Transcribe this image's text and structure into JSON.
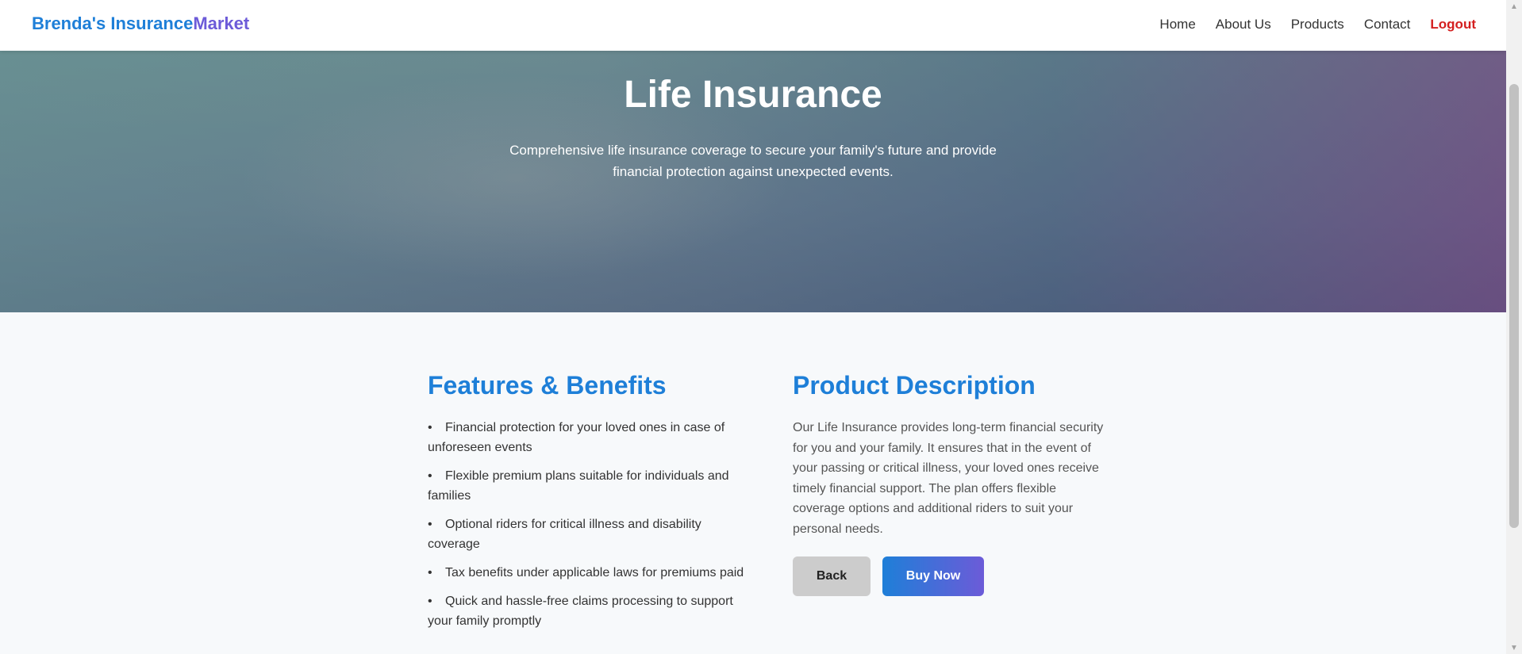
{
  "header": {
    "brand_part1": "Brenda's Insurance",
    "brand_part2": "Market",
    "nav": {
      "home": "Home",
      "about": "About Us",
      "products": "Products",
      "contact": "Contact",
      "logout": "Logout"
    }
  },
  "hero": {
    "title": "Life Insurance",
    "subtitle": "Comprehensive life insurance coverage to secure your family's future and provide financial protection against unexpected events."
  },
  "features": {
    "heading": "Features & Benefits",
    "items": [
      "Financial protection for your loved ones in case of unforeseen events",
      "Flexible premium plans suitable for individuals and families",
      "Optional riders for critical illness and disability coverage",
      "Tax benefits under applicable laws for premiums paid",
      "Quick and hassle-free claims processing to support your family promptly"
    ]
  },
  "description": {
    "heading": "Product Description",
    "body": "Our Life Insurance provides long-term financial security for you and your family. It ensures that in the event of your passing or critical illness, your loved ones receive timely financial support. The plan offers flexible coverage options and additional riders to suit your personal needs.",
    "back_label": "Back",
    "buy_label": "Buy Now"
  },
  "scrollbar": {
    "up_icon": "▲",
    "down_icon": "▼"
  },
  "colors": {
    "brand_blue": "#1e7fd8",
    "brand_purple": "#6c5bd8",
    "logout_red": "#d42020"
  }
}
